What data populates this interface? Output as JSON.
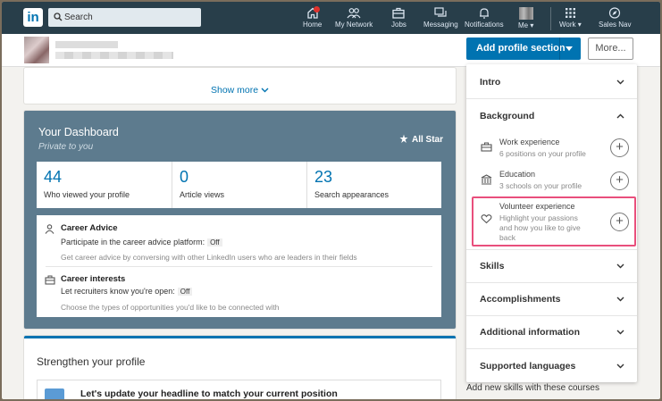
{
  "nav": {
    "logo": "in",
    "search_placeholder": "Search",
    "items": [
      {
        "label": "Home",
        "icon": "home-icon"
      },
      {
        "label": "My Network",
        "icon": "network-icon"
      },
      {
        "label": "Jobs",
        "icon": "briefcase-icon"
      },
      {
        "label": "Messaging",
        "icon": "messaging-icon"
      },
      {
        "label": "Notifications",
        "icon": "bell-icon"
      },
      {
        "label": "Me ▾",
        "icon": "avatar"
      },
      {
        "label": "Work ▾",
        "icon": "grid-icon"
      },
      {
        "label": "Sales Nav",
        "icon": "compass-icon"
      }
    ]
  },
  "profile_bar": {
    "add_section_label": "Add profile section",
    "more_label": "More..."
  },
  "show_more": "Show more",
  "dashboard": {
    "title": "Your Dashboard",
    "subtitle": "Private to you",
    "all_star": "All Star",
    "stats": [
      {
        "value": "44",
        "label": "Who viewed your profile"
      },
      {
        "value": "0",
        "label": "Article views"
      },
      {
        "value": "23",
        "label": "Search appearances"
      }
    ],
    "career_advice": {
      "title": "Career Advice",
      "line": "Participate in the career advice platform:",
      "state": "Off",
      "desc": "Get career advice by conversing with other LinkedIn users who are leaders in their fields"
    },
    "career_interests": {
      "title": "Career interests",
      "line": "Let recruiters know you're open:",
      "state": "Off",
      "desc": "Choose the types of opportunities you'd like to be connected with"
    }
  },
  "strengthen": {
    "title": "Strengthen your profile",
    "item": "Let's update your headline to match your current position"
  },
  "dropdown": {
    "intro": "Intro",
    "background": "Background",
    "items": [
      {
        "title": "Work experience",
        "sub": "6 positions on your profile"
      },
      {
        "title": "Education",
        "sub": "3 schools on your profile"
      },
      {
        "title": "Volunteer experience",
        "sub": "Highlight your passions and how you like to give back"
      }
    ],
    "skills": "Skills",
    "accomplishments": "Accomplishments",
    "additional": "Additional information",
    "languages": "Supported languages"
  },
  "below_text": "Add new skills with these courses",
  "colors": {
    "nav": "#283e4a",
    "accent": "#0073b1",
    "highlight": "#e94f7c",
    "dashboard": "#5d7b8e"
  }
}
